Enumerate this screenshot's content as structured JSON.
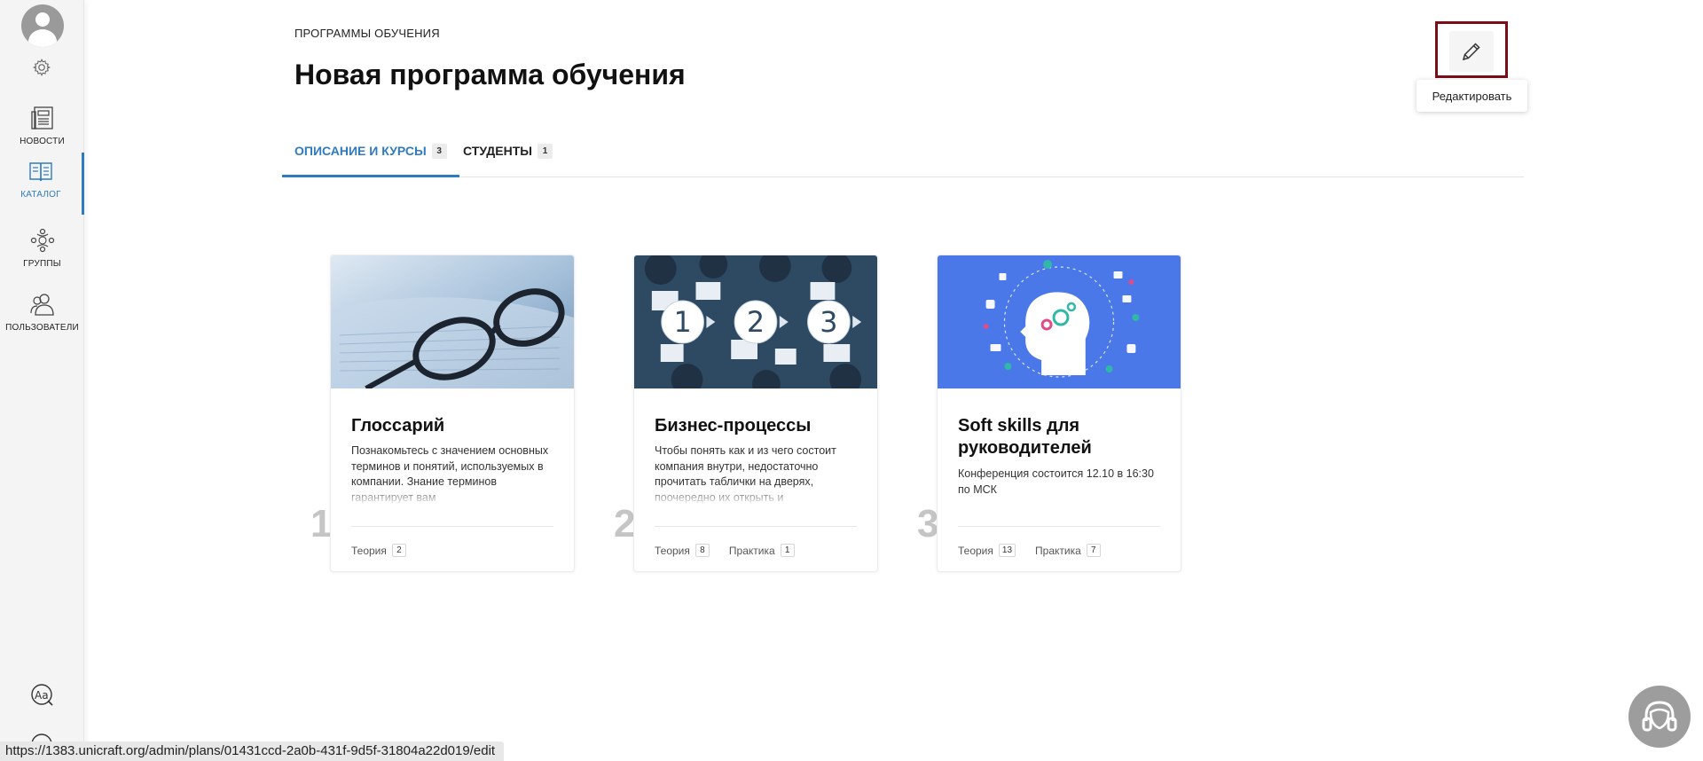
{
  "sidebar": {
    "items": [
      {
        "label": "НОВОСТИ",
        "icon": "newspaper-icon"
      },
      {
        "label": "КАТАЛОГ",
        "icon": "book-icon"
      },
      {
        "label": "ГРУППЫ",
        "icon": "groups-icon"
      },
      {
        "label": "ПОЛЬЗОВАТЕЛИ",
        "icon": "users-icon"
      }
    ],
    "active_index": 1
  },
  "header": {
    "breadcrumb": "ПРОГРАММЫ ОБУЧЕНИЯ",
    "title": "Новая программа обучения",
    "edit_tooltip": "Редактировать"
  },
  "tabs": [
    {
      "label": "ОПИСАНИЕ И КУРСЫ",
      "count": "3"
    },
    {
      "label": "СТУДЕНТЫ",
      "count": "1"
    }
  ],
  "courses": [
    {
      "number": "1",
      "title": "Глоссарий",
      "description": "Познакомьтесь с значением основных терминов и понятий, используемых в компании. Знание терминов гарантирует вам",
      "stats": [
        {
          "label": "Теория",
          "count": "2"
        }
      ]
    },
    {
      "number": "2",
      "title": "Бизнес-процессы",
      "description": "Чтобы понять как и из чего состоит компания внутри, недостаточно прочитать таблички на дверях, поочередно их открыть и",
      "stats": [
        {
          "label": "Теория",
          "count": "8"
        },
        {
          "label": "Практика",
          "count": "1"
        }
      ]
    },
    {
      "number": "3",
      "title": "Soft skills для руководителей",
      "description": "Конференция состоится 12.10 в 16:30 по МСК",
      "stats": [
        {
          "label": "Теория",
          "count": "13"
        },
        {
          "label": "Практика",
          "count": "7"
        }
      ]
    }
  ],
  "status_bar": {
    "url": "https://1383.unicraft.org/admin/plans/01431ccd-2a0b-431f-9d5f-31804a22d019/edit"
  },
  "colors": {
    "accent": "#2f7bc1",
    "highlight_box": "#7a0d18",
    "card_cover_3": "#4a78e8"
  }
}
